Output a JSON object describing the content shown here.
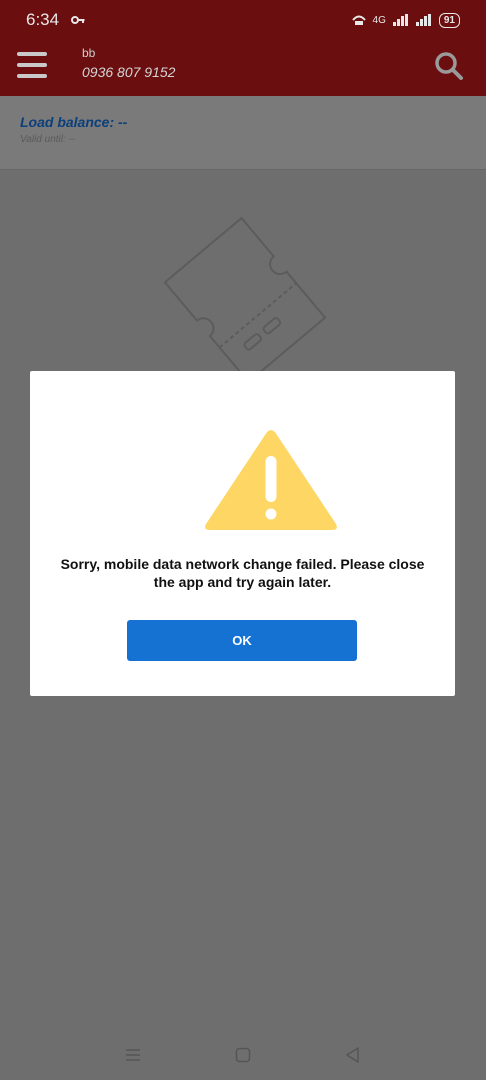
{
  "status_bar": {
    "time": "6:34",
    "network": "4G",
    "battery": "91"
  },
  "header": {
    "account_name": "bb",
    "account_number": "0936 807 9152"
  },
  "balance": {
    "load_balance": "Load balance: --",
    "valid_until": "Valid until: --"
  },
  "dialog": {
    "message": "Sorry, mobile data network change failed. Please close the app and try again later.",
    "ok_label": "OK",
    "warning_color": "#fdd663",
    "button_color": "#1572d2"
  },
  "colors": {
    "header_bg": "#6a0e10",
    "overlay_bg": "#6e6e6e"
  },
  "icons": {
    "menu": "hamburger-icon",
    "search": "search-icon",
    "warning": "warning-icon",
    "empty_state": "ticket-icon"
  }
}
